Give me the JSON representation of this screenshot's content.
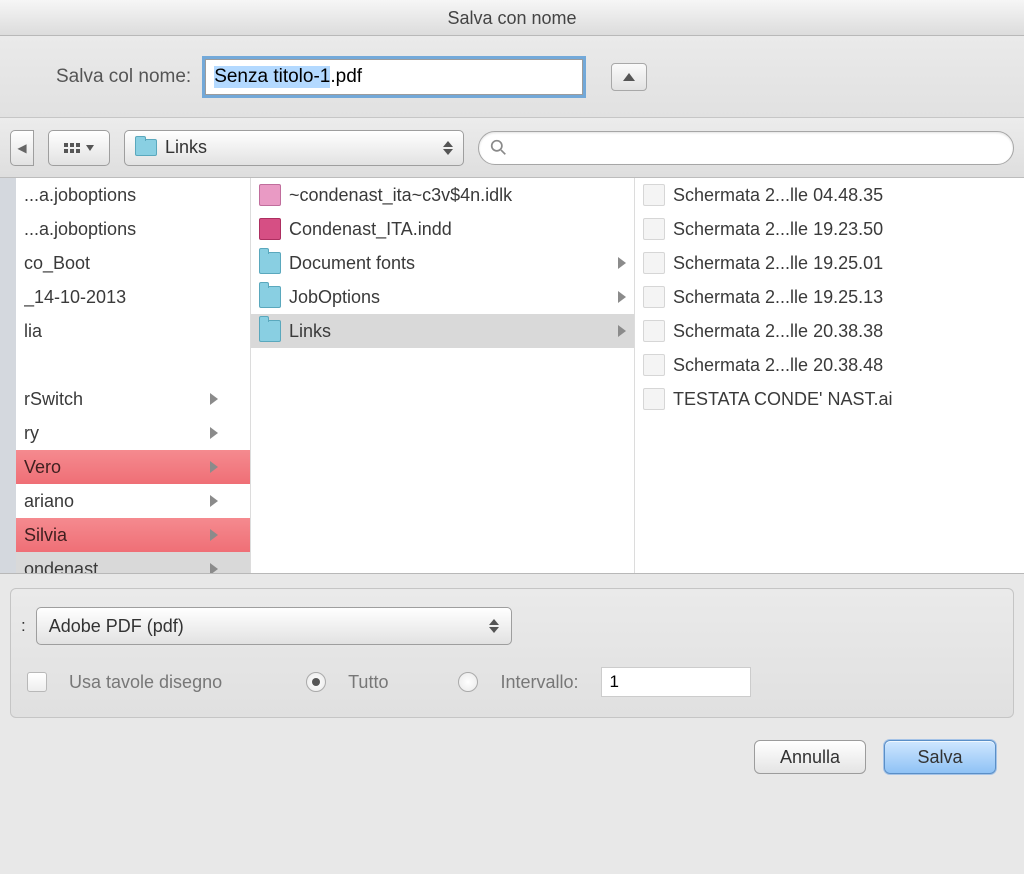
{
  "dialog": {
    "title": "Salva con nome"
  },
  "save_as": {
    "label": "Salva col nome:",
    "filename": "Senza titolo-1.pdf",
    "selected_part": "Senza titolo-1"
  },
  "toolbar": {
    "location": "Links",
    "search_placeholder": ""
  },
  "col1": [
    {
      "label": "...a.joboptions",
      "red": false,
      "chev": false
    },
    {
      "label": "...a.joboptions",
      "red": false,
      "chev": false
    },
    {
      "label": "co_Boot",
      "red": false,
      "chev": false
    },
    {
      "label": "_14-10-2013",
      "red": false,
      "chev": false
    },
    {
      "label": "lia",
      "red": false,
      "chev": false
    },
    {
      "label": "",
      "blank": true
    },
    {
      "label": "rSwitch",
      "red": false,
      "chev": true
    },
    {
      "label": "ry",
      "red": false,
      "chev": true
    },
    {
      "label": "Vero",
      "red": true,
      "chev": true
    },
    {
      "label": "ariano",
      "red": false,
      "chev": true
    },
    {
      "label": "Silvia",
      "red": true,
      "chev": true
    },
    {
      "label": "ondenast",
      "red": false,
      "chev": true,
      "sel": true
    }
  ],
  "col2": [
    {
      "label": "~condenast_ita~c3v$4n.idlk",
      "icon": "lock",
      "chev": false
    },
    {
      "label": "Condenast_ITA.indd",
      "icon": "indd",
      "chev": false
    },
    {
      "label": "Document fonts",
      "icon": "folder",
      "chev": true
    },
    {
      "label": "JobOptions",
      "icon": "folder",
      "chev": true
    },
    {
      "label": "Links",
      "icon": "folder",
      "chev": true,
      "sel": true
    }
  ],
  "col3": [
    {
      "label": "Schermata 2...lle 04.48.35",
      "icon": "dim"
    },
    {
      "label": "Schermata 2...lle 19.23.50",
      "icon": "dim"
    },
    {
      "label": "Schermata 2...lle 19.25.01",
      "icon": "dim"
    },
    {
      "label": "Schermata 2...lle 19.25.13",
      "icon": "dim"
    },
    {
      "label": "Schermata 2...lle 20.38.38",
      "icon": "dim"
    },
    {
      "label": "Schermata 2...lle 20.38.48",
      "icon": "dim"
    },
    {
      "label": "TESTATA CONDE' NAST.ai",
      "icon": "dim"
    }
  ],
  "format": {
    "prefix_label": ":",
    "value": "Adobe PDF (pdf)"
  },
  "options": {
    "artboards_label": "Usa tavole disegno",
    "all_label": "Tutto",
    "range_label": "Intervallo:",
    "range_value": "1"
  },
  "buttons": {
    "cancel": "Annulla",
    "save": "Salva"
  }
}
